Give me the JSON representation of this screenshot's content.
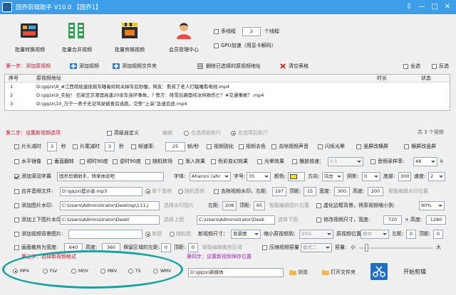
{
  "window": {
    "title": "固乔剪辑助手 V10.0  【固乔1】",
    "controls": [
      "⇩",
      "—",
      "□",
      "✕"
    ]
  },
  "toolbar": {
    "buttons": [
      "批量转换视频",
      "批量合并视频",
      "批量剪辑视频",
      "会员管理中心"
    ],
    "multithread_label": "多线程",
    "thread_count": "2",
    "thread_unit": "个线程",
    "gpu_label": "GPU加速（用显卡解码）"
  },
  "step1": {
    "title": "第一步：添加原视频",
    "add_video": "添加视频",
    "add_folder": "添加视频文件夹",
    "delete_selected": "删除已选择的原视频地址",
    "clear_table": "清空表格",
    "select_all": "全选",
    "invert": "反选"
  },
  "table": {
    "headers": [
      "序号",
      "原视频地址",
      "时长",
      "状态"
    ],
    "rows": [
      {
        "index": "1",
        "path": "D:\\gqzx\\8_#江西萌娃蛋摇摇车睡着妈妈关掉车后秒醒，网友：詹叔了老人打瞌睡看电视.mp4"
      },
      {
        "index": "2",
        "path": "D:\\gqzx\\9_实拍！ 石家庄京港澳高速20余车连环事故，? 警方：降雪后路面结冰所致伤亡？#交通事故？.mp4"
      },
      {
        "index": "3",
        "path": "D:\\gqzx\\10_万宁一男子无证驾驶被查后逃跑，交警“上演”急速追逐.mp4"
      }
    ]
  },
  "step2": {
    "title": "第二步：设置新视频选项",
    "advanced": "高级自定义",
    "edit": "编辑",
    "run_current": "在选项前执行",
    "run_after": "在选项后执行",
    "count": "共 3 个视频"
  },
  "opt_row1": {
    "cut_head": "片头减时",
    "head_val": "3",
    "sec1": "秒",
    "cut_tail": "片尾减时",
    "tail_val": "3",
    "sec2": "秒",
    "fps_label": "帧速率:",
    "fps_val": "25",
    "fps_unit": "帧/秒",
    "sharpen": "视频锐化",
    "color": "视频去色",
    "remove_audio": "去除视频声音",
    "flash": "闪烁光晕",
    "portrait_to_landscape": "竖屏改横屏",
    "landscape_to_portrait": "横屏改竖屏"
  },
  "opt_row2": {
    "mirror_h": "水平镜像",
    "flip_v": "垂直翻转",
    "rotate90": "顺时90度",
    "rotate_ccw": "逆时90度",
    "random_transition": "随机转场",
    "fade": "渐入效果",
    "color_effect": "色彩变幻效果",
    "light": "光晕效果",
    "speed_label": "播放倍速：",
    "speed_val": "0.5",
    "audio_rate": "音频采样率:",
    "audio_rate_val": "48",
    "audio_unit": "k"
  },
  "opt_row3": {
    "add_subtitle": "添加滚动字幕",
    "subtitle_text": "固乔剪辑助手，快来体验吧",
    "font_label": "字体:",
    "font_val": "Aharoni (ahr",
    "size_label": "字号:",
    "size_val": "35",
    "color_label": "颜色:",
    "direction_label": "方向:",
    "direction_val": "向左",
    "shadow_label": "阴影:",
    "shadow_val": "0",
    "bottom_label": "底部:",
    "bottom_val": "300",
    "speed_label": "速度:",
    "speed_val": "2"
  },
  "opt_row4": {
    "merge_audio": "合并音频文件:",
    "audio_path": "D:\\gqzx\\提示音.mp3",
    "single_audio": "单个音频",
    "random_audio": "随机音频",
    "remove_watermark": "去除视频水印，左距:",
    "left_val": "197",
    "top_label": "顶距:",
    "top_val": "15",
    "width_label": "宽度:",
    "width_val": "300",
    "height_label": "高度:",
    "height_val": "200",
    "smart_remove": "智能编辑水印位置"
  },
  "opt_row5": {
    "add_image_watermark": "添加图片水印:",
    "img_path": "C:\\Users\\Administrator\\Desktop\\111.j",
    "select_image": "选择水印图片",
    "left_label": "左距:",
    "left_val": "208",
    "top_label": "顶距:",
    "top_val": "65",
    "smart_pos": "智能编辑图片位置",
    "blur_bg": "虚化边框背景，将原视频缩小到:",
    "blur_val": "90%"
  },
  "opt_row6": {
    "add_top_bottom": "添加上下图片水印:",
    "path": "C:\\Users\\Administrator\\Deskt",
    "select_top": "选择上图",
    "path2": "C:\\Users\\Administrator\\Desk",
    "select_bottom": "选择下图",
    "resize": "修改视频尺寸，宽度:",
    "width_val": "720",
    "x": "×",
    "height_label": "高度:",
    "height_val": "1280"
  },
  "opt_row7": {
    "add_bg_image": "添加视频背景图片:",
    "single_image": "单图",
    "random_image": "随机图",
    "new_size_label": "新视频尺寸：",
    "new_size_val": "背景图",
    "scale_label": "缩小原视频到:",
    "scale_val": "95%",
    "position_label": "原视频位置：",
    "position_val": "居中",
    "left_label": "左距:",
    "left_val": "0",
    "top_label": "顶距:",
    "top_val": "0"
  },
  "opt_row8": {
    "crop": "画面裁剪为宽度:",
    "crop_w": "640",
    "height_label": "高度:",
    "crop_h": "360",
    "keep_crop": "保留区域的左距:",
    "keep_val": "0",
    "top_label": "顶距:",
    "top_val": "0",
    "smart_crop": "智能编辑裁剪区域",
    "compress": "压缩视频容量",
    "compress_val": "模式二",
    "size_label": "容量:",
    "small": "小",
    "large": "大"
  },
  "step3": {
    "title": "第三步：选择新视频格式",
    "formats": [
      "MP4",
      "FLV",
      "MOV",
      "MKV",
      "TS",
      "WMV"
    ],
    "selected": "MP4"
  },
  "step4": {
    "title": "第四步：设置新视频保存位置",
    "path": "D:\\gqzx\\新媒体",
    "browse": "浏览",
    "open_folder": "打开文件夹",
    "start": "开始剪辑"
  },
  "colors": {
    "titlebar": "#3c9ee8",
    "section_red": "#c8102e",
    "section_purple": "#9b22b8",
    "highlight": "#18a3a0",
    "yellow": "#ffe800"
  }
}
